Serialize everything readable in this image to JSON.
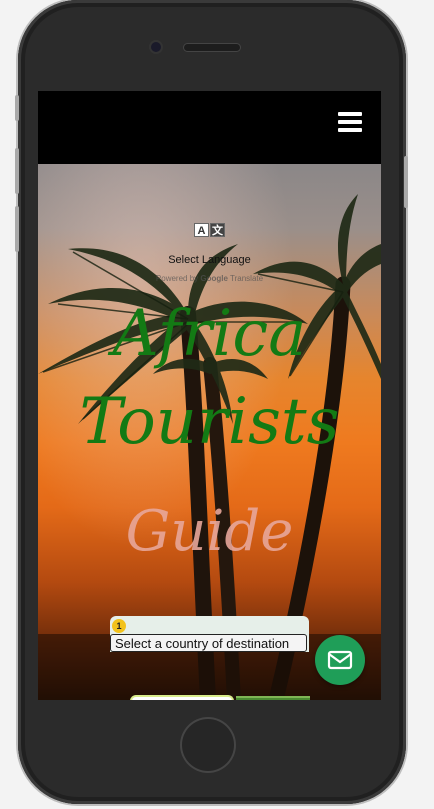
{
  "header": {
    "menu_icon": "hamburger-icon"
  },
  "translate": {
    "icon": "translate-icon",
    "icon_left": "A",
    "icon_right": "文",
    "select_label": "Select Language",
    "powered_prefix": "Powered by",
    "powered_brand": "Google",
    "powered_suffix": "Translate"
  },
  "hero": {
    "title_line1": "Africa",
    "title_line2": "Tourists",
    "title_line3": "Guide"
  },
  "country": {
    "badge_count": "1",
    "placeholder": "Select a country of destination"
  },
  "contact": {
    "icon": "mail-icon"
  },
  "colors": {
    "title_green": "#137a14",
    "title_pink": "#e8a79a",
    "mail_button": "#1f9e58",
    "badge": "#f3c21b"
  }
}
